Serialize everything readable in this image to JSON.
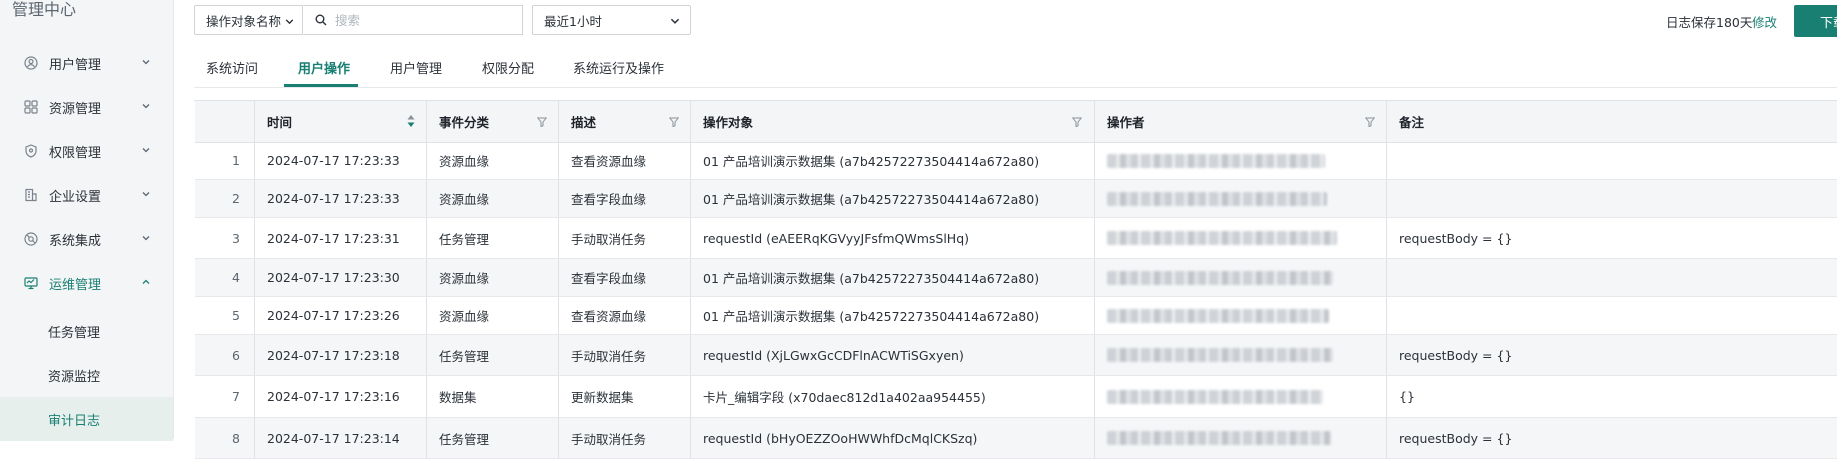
{
  "app_title": "管理中心",
  "colors": {
    "accent": "#1a7f73",
    "sidebar_bg": "#f3f5f7",
    "header_bg": "#f3f5f7"
  },
  "sidebar": {
    "items": [
      {
        "label": "用户管理",
        "icon": "user-icon"
      },
      {
        "label": "资源管理",
        "icon": "grid-icon"
      },
      {
        "label": "权限管理",
        "icon": "shield-icon"
      },
      {
        "label": "企业设置",
        "icon": "building-icon"
      },
      {
        "label": "系统集成",
        "icon": "integration-icon"
      },
      {
        "label": "运维管理",
        "icon": "monitor-icon",
        "active": true,
        "expanded": true
      }
    ],
    "sub_items": [
      {
        "label": "任务管理"
      },
      {
        "label": "资源监控"
      },
      {
        "label": "审计日志",
        "active": true
      }
    ]
  },
  "toolbar": {
    "field_select": "操作对象名称",
    "search_placeholder": "搜索",
    "time_select": "最近1小时",
    "retention_text": "日志保存180天",
    "modify_link": "修改",
    "download_label": "下载"
  },
  "tabs": [
    {
      "label": "系统访问"
    },
    {
      "label": "用户操作",
      "active": true
    },
    {
      "label": "用户管理"
    },
    {
      "label": "权限分配"
    },
    {
      "label": "系统运行及操作"
    }
  ],
  "table": {
    "columns": [
      "时间",
      "事件分类",
      "描述",
      "操作对象",
      "操作者",
      "备注"
    ],
    "rows": [
      {
        "idx": "1",
        "time": "2024-07-17 17:23:33",
        "category": "资源血缘",
        "desc": "查看资源血缘",
        "target": "01 产品培训演示数据集 (a7b42572273504414a672a80)",
        "remark": ""
      },
      {
        "idx": "2",
        "time": "2024-07-17 17:23:33",
        "category": "资源血缘",
        "desc": "查看字段血缘",
        "target": "01 产品培训演示数据集 (a7b42572273504414a672a80)",
        "remark": ""
      },
      {
        "idx": "3",
        "time": "2024-07-17 17:23:31",
        "category": "任务管理",
        "desc": "手动取消任务",
        "target": "requestId (eAEERqKGVyyJFsfmQWmsSlHq)",
        "remark": "requestBody = {}"
      },
      {
        "idx": "4",
        "time": "2024-07-17 17:23:30",
        "category": "资源血缘",
        "desc": "查看字段血缘",
        "target": "01 产品培训演示数据集 (a7b42572273504414a672a80)",
        "remark": ""
      },
      {
        "idx": "5",
        "time": "2024-07-17 17:23:26",
        "category": "资源血缘",
        "desc": "查看资源血缘",
        "target": "01 产品培训演示数据集 (a7b42572273504414a672a80)",
        "remark": ""
      },
      {
        "idx": "6",
        "time": "2024-07-17 17:23:18",
        "category": "任务管理",
        "desc": "手动取消任务",
        "target": "requestId (XjLGwxGcCDFlnACWTiSGxyen)",
        "remark": "requestBody = {}"
      },
      {
        "idx": "7",
        "time": "2024-07-17 17:23:16",
        "category": "数据集",
        "desc": "更新数据集",
        "target": "卡片_编辑字段 (x70daec812d1a402aa954455)",
        "remark": "{}"
      },
      {
        "idx": "8",
        "time": "2024-07-17 17:23:14",
        "category": "任务管理",
        "desc": "手动取消任务",
        "target": "requestId (bHyOEZZOoHWWhfDcMqlCKSzq)",
        "remark": "requestBody = {}"
      }
    ]
  }
}
